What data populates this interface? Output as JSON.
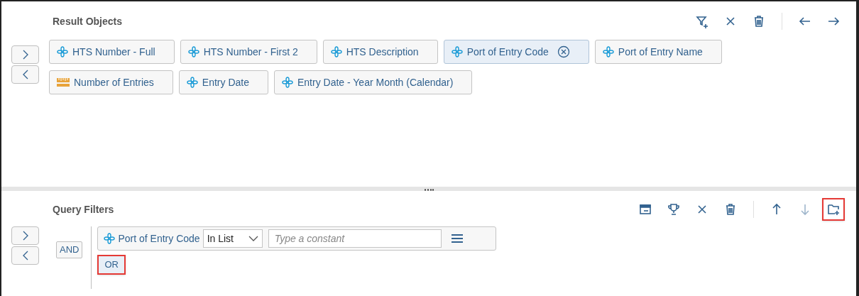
{
  "result_objects": {
    "title": "Result Objects",
    "toolbar": [
      {
        "kind": "filter-add",
        "disabled": false
      },
      {
        "kind": "close",
        "disabled": false
      },
      {
        "kind": "delete",
        "disabled": false
      },
      {
        "kind": "divider"
      },
      {
        "kind": "arrow-left",
        "disabled": false
      },
      {
        "kind": "arrow-right",
        "disabled": false
      }
    ],
    "rows": [
      [
        {
          "label": "HTS Number - Full",
          "kind": "dimension",
          "selected": false
        },
        {
          "label": "HTS Number - First 2",
          "kind": "dimension",
          "selected": false
        },
        {
          "label": "HTS Description",
          "kind": "dimension",
          "selected": false
        },
        {
          "label": "Port of Entry Code",
          "kind": "dimension",
          "selected": true
        },
        {
          "label": "Port of Entry Name",
          "kind": "dimension",
          "selected": false
        }
      ],
      [
        {
          "label": "Number of Entries",
          "kind": "measure",
          "selected": false
        },
        {
          "label": "Entry Date",
          "kind": "dimension",
          "selected": false
        },
        {
          "label": "Entry Date - Year Month (Calendar)",
          "kind": "dimension",
          "selected": false
        }
      ]
    ]
  },
  "query_filters": {
    "title": "Query Filters",
    "toolbar": [
      {
        "kind": "panel",
        "disabled": false,
        "highlighted": false
      },
      {
        "kind": "trophy",
        "disabled": false,
        "highlighted": false
      },
      {
        "kind": "close",
        "disabled": false,
        "highlighted": false
      },
      {
        "kind": "delete",
        "disabled": false,
        "highlighted": false
      },
      {
        "kind": "divider"
      },
      {
        "kind": "arrow-up",
        "disabled": false,
        "highlighted": false
      },
      {
        "kind": "arrow-down",
        "disabled": true,
        "highlighted": false
      },
      {
        "kind": "folder-add",
        "disabled": false,
        "highlighted": true
      }
    ],
    "operator": "AND",
    "filter": {
      "object": "Port of Entry Code",
      "operator": "In List",
      "placeholder": "Type a constant"
    },
    "or_button": {
      "label": "OR",
      "highlighted": true
    }
  }
}
